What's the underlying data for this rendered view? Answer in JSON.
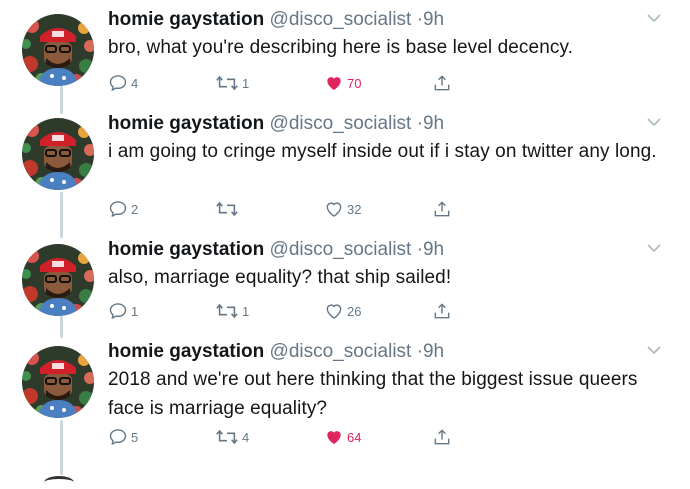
{
  "tweets": [
    {
      "name": "homie gaystation",
      "handle": "@disco_socialist",
      "dot": "·",
      "time": "9h",
      "text": "bro, what you're describing here is base level decency.",
      "replies": "4",
      "retweets": "1",
      "likes": "70",
      "liked": true
    },
    {
      "name": "homie gaystation",
      "handle": "@disco_socialist",
      "dot": "·",
      "time": "9h",
      "text": "i am going to cringe myself inside out if i stay on twitter any long.",
      "replies": "2",
      "retweets": "",
      "likes": "32",
      "liked": false
    },
    {
      "name": "homie gaystation",
      "handle": "@disco_socialist",
      "dot": "·",
      "time": "9h",
      "text": "also, marriage equality? that ship sailed!",
      "replies": "1",
      "retweets": "1",
      "likes": "26",
      "liked": false
    },
    {
      "name": "homie gaystation",
      "handle": "@disco_socialist",
      "dot": "·",
      "time": "9h",
      "text": "2018 and we're out here thinking that the biggest issue queers face is marriage equality?",
      "replies": "5",
      "retweets": "4",
      "likes": "64",
      "liked": true
    }
  ],
  "colors": {
    "liked": "#e0245e",
    "muted": "#657786",
    "thread_line": "#ccd6dd"
  },
  "icons": [
    "reply-icon",
    "retweet-icon",
    "like-icon",
    "share-icon",
    "chevron-down-icon"
  ]
}
